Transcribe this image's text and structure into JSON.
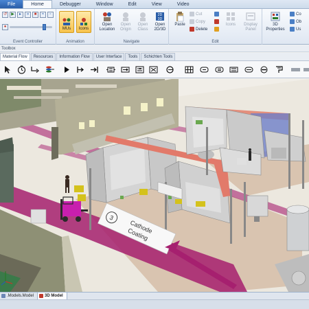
{
  "menu": {
    "tabs": [
      "File",
      "Home",
      "Debugger",
      "Window",
      "Edit",
      "View",
      "Video"
    ],
    "active": "Home"
  },
  "ribbon": {
    "event_controller": {
      "label": "Event Controller"
    },
    "animation": {
      "label": "Animation",
      "muis": "MUs",
      "icons": "Icons"
    },
    "navigate": {
      "label": "Navigate",
      "open_location": "Open Location",
      "open_origin": "Open Origin",
      "open_class": "Open Class",
      "open_2d3d": "Open 2D/3D"
    },
    "edit": {
      "label": "Edit",
      "paste": "Paste",
      "cut": "Cut",
      "copy": "Copy",
      "delete": "Delete",
      "icons": "Icons",
      "display_panel": "Display Panel"
    },
    "properties": {
      "label": "3D Properties",
      "co": "Co",
      "ob": "Ob",
      "us": "Us"
    }
  },
  "toolbox": {
    "title": "Toolbox",
    "tabs": [
      "Material Flow",
      "Resources",
      "Information Flow",
      "User Interface",
      "Tools",
      "Schichten Tools"
    ],
    "active_tab": "Material Flow"
  },
  "scene": {
    "floor_label_number": "3",
    "floor_label_text_1": "Cathode",
    "floor_label_text_2": "Coating"
  },
  "doctabs": [
    {
      "label": ".Models.Model",
      "active": false
    },
    {
      "label": "3D Model",
      "active": true
    }
  ],
  "colors": {
    "accent": "#2a5ea8",
    "floor_path": "#a6206f",
    "forklift": "#c81fae",
    "machine": "#d8d8d8"
  }
}
